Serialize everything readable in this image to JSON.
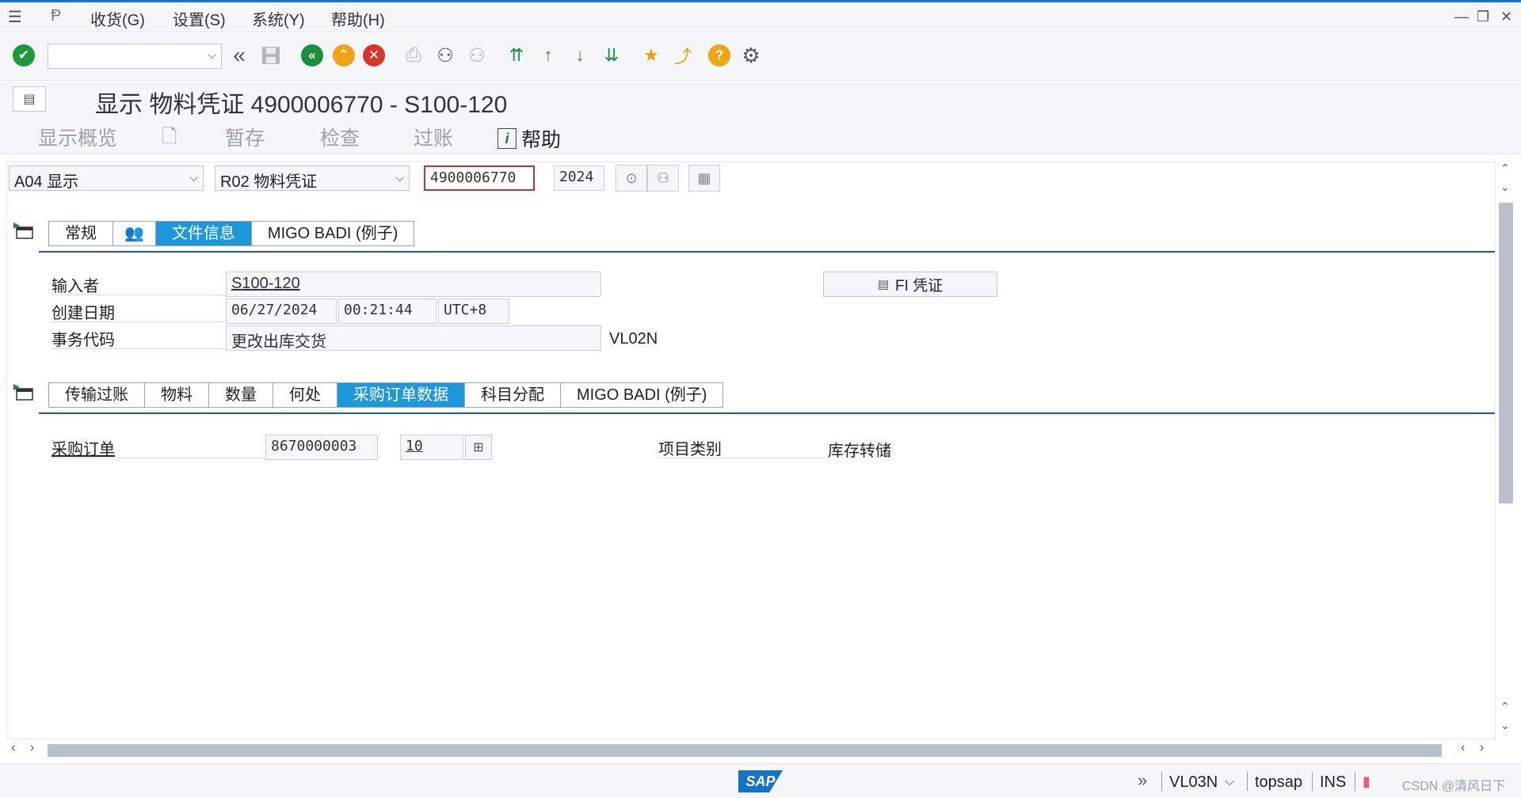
{
  "menu": {
    "items": [
      "收货(G)",
      "设置(S)",
      "系统(Y)",
      "帮助(H)"
    ]
  },
  "toolbar": {
    "command_value": "",
    "command_placeholder": ""
  },
  "title": "显示 物料凭证 4900006770 - S100-120",
  "app_toolbar": {
    "overview": "显示概览",
    "hold": "暂存",
    "check": "检查",
    "post": "过账",
    "help": "帮助"
  },
  "header": {
    "action_select": "A04 显示",
    "ref_select": "R02 物料凭证",
    "doc_number": "4900006770",
    "year": "2024"
  },
  "tabs_top": {
    "items": [
      "常规",
      "",
      "文件信息",
      "MIGO BADI (例子)"
    ],
    "active_index": 2
  },
  "doc_info": {
    "entered_by_label": "输入者",
    "entered_by": "S100-120",
    "created_label": "创建日期",
    "created_date": "06/27/2024",
    "created_time": "00:21:44",
    "timezone": "UTC+8",
    "tcode_label": "事务代码",
    "tcode_text": "更改出库交货",
    "tcode": "VL02N",
    "fi_button": "FI 凭证"
  },
  "tabs_bottom": {
    "items": [
      "传输过账",
      "物料",
      "数量",
      "何处",
      "采购订单数据",
      "科目分配",
      "MIGO BADI (例子)"
    ],
    "active_index": 4
  },
  "po_data": {
    "po_label": "采购订单",
    "po_number": "8670000003",
    "po_item": "10",
    "item_cat_label": "项目类别",
    "item_cat_value": "库存转储"
  },
  "status": {
    "tcode": "VL03N",
    "system": "topsap",
    "mode": "INS",
    "watermark": "CSDN @清风日下"
  },
  "colors": {
    "accent": "#1e97dc",
    "rule": "#1a5ea8",
    "ok_green": "#1f9a3a",
    "nav_green": "#1a8f3c",
    "exit_orange": "#f0a315",
    "cancel_red": "#d9342b"
  }
}
